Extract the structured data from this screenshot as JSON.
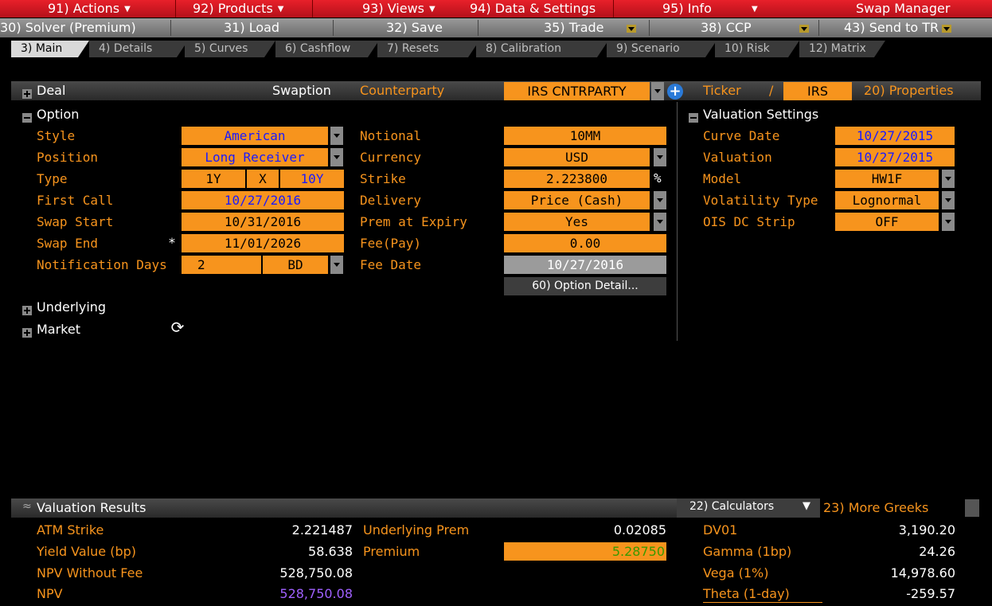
{
  "menubar": {
    "actions": "91) Actions",
    "products": "92) Products",
    "views": "93) Views",
    "data_settings": "94) Data & Settings",
    "info": "95) Info",
    "app_title": "Swap Manager"
  },
  "buttonbar": {
    "solver": "30) Solver (Premium)",
    "load": "31) Load",
    "save": "32) Save",
    "trade": "35) Trade",
    "ccp": "38) CCP",
    "send_tr": "43) Send to TR"
  },
  "tabs": [
    "3) Main",
    "4) Details",
    "5) Curves",
    "6) Cashflow",
    "7) Resets",
    "8) Calibration",
    "9) Scenario",
    "10) Risk",
    "12) Matrix"
  ],
  "deal": {
    "label": "Deal",
    "type": "Swaption",
    "counterparty_label": "Counterparty",
    "counterparty_value": "IRS CNTRPARTY",
    "ticker_label": "Ticker",
    "ticker_sep": "/",
    "ticker_value": "IRS",
    "properties": "20) Properties"
  },
  "option": {
    "header": "Option",
    "style_label": "Style",
    "style_value": "American",
    "position_label": "Position",
    "position_value": "Long Receiver",
    "type_label": "Type",
    "type_value1": "1Y",
    "type_x": "X",
    "type_value2": "10Y",
    "first_call_label": "First Call",
    "first_call_value": "10/27/2016",
    "swap_start_label": "Swap Start",
    "swap_start_value": "10/31/2016",
    "swap_end_label": "Swap End",
    "swap_end_marker": "*",
    "swap_end_value": "11/01/2026",
    "notif_label": "Notification Days",
    "notif_value": "2",
    "notif_unit": "BD",
    "notional_label": "Notional",
    "notional_value": "10MM",
    "currency_label": "Currency",
    "currency_value": "USD",
    "strike_label": "Strike",
    "strike_value": "2.223800",
    "strike_unit": "%",
    "delivery_label": "Delivery",
    "delivery_value": "Price (Cash)",
    "prem_label": "Prem at Expiry",
    "prem_value": "Yes",
    "fee_label": "Fee(Pay)",
    "fee_value": "0.00",
    "fee_date_label": "Fee Date",
    "fee_date_value": "10/27/2016",
    "option_detail_btn": "60) Option Detail..."
  },
  "valuation_settings": {
    "header": "Valuation Settings",
    "curve_date_label": "Curve Date",
    "curve_date_value": "10/27/2015",
    "valuation_label": "Valuation",
    "valuation_value": "10/27/2015",
    "model_label": "Model",
    "model_value": "HW1F",
    "vol_type_label": "Volatility Type",
    "vol_type_value": "Lognormal",
    "ois_label": "OIS DC Strip",
    "ois_value": "OFF"
  },
  "sections": {
    "underlying": "Underlying",
    "market": "Market"
  },
  "results": {
    "header": "Valuation Results",
    "calculators": "22) Calculators",
    "more_greeks": "23) More Greeks",
    "atm_strike_label": "ATM Strike",
    "atm_strike_value": "2.221487",
    "yield_label": "Yield Value (bp)",
    "yield_value": "58.638",
    "npv_wo_fee_label": "NPV Without Fee",
    "npv_wo_fee_value": "528,750.08",
    "npv_label": "NPV",
    "npv_value": "528,750.08",
    "und_prem_label": "Underlying Prem",
    "und_prem_value": "0.02085",
    "premium_label": "Premium",
    "premium_value": "5.28750",
    "dv01_label": "DV01",
    "dv01_value": "3,190.20",
    "gamma_label": "Gamma (1bp)",
    "gamma_value": "24.26",
    "vega_label": "Vega (1%)",
    "vega_value": "14,978.60",
    "theta_label": "Theta (1-day)",
    "theta_value": "-259.57"
  },
  "colors": {
    "menu_red": "#d41820",
    "field_orange": "#f7941d",
    "label_orange": "#f7941d",
    "npv_purple": "#a060ff",
    "premium_green": "#3a9a00",
    "blue_text": "#1a1aff"
  }
}
